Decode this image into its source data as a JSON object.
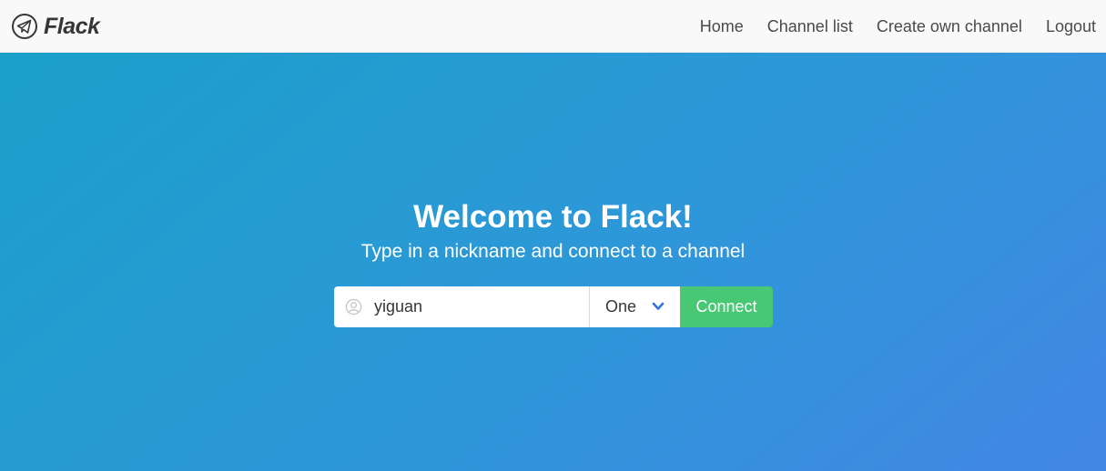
{
  "navbar": {
    "brand": "Flack",
    "brand_icon": "telegram-plane-icon",
    "links": [
      {
        "label": "Home"
      },
      {
        "label": "Channel list"
      },
      {
        "label": "Create own channel"
      },
      {
        "label": "Logout"
      }
    ]
  },
  "hero": {
    "title": "Welcome to Flack!",
    "subtitle": "Type in a nickname and connect to a channel",
    "gradient_colors": [
      "#1aa0c9",
      "#2e97d9",
      "#4386e4"
    ]
  },
  "form": {
    "nickname_value": "yiguan",
    "nickname_icon": "user-circle-icon",
    "channel_selected": "One",
    "connect_label": "Connect",
    "accent_color": "#48c774",
    "chevron_color": "#3273dc"
  }
}
